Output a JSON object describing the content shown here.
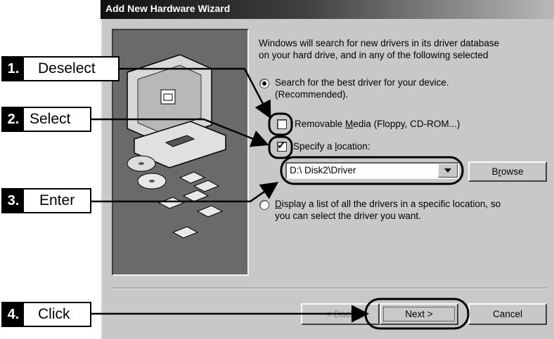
{
  "window": {
    "title": "Add New Hardware Wizard"
  },
  "content": {
    "intro_line1": "Windows will search for new drivers in its driver database",
    "intro_line2": "on your hard drive, and in any of the following selected",
    "radio_best_line1": "Search for the best driver for your device.",
    "radio_best_line2": "(Recommended).",
    "cb_removable_pre": "Removable ",
    "cb_removable_key": "M",
    "cb_removable_post": "edia (Floppy, CD-ROM...)",
    "cb_location_pre": "Specify a ",
    "cb_location_key": "l",
    "cb_location_post": "ocation:",
    "location_value": "D:\\ Disk2\\Driver",
    "browse_pre": "B",
    "browse_key": "r",
    "browse_post": "owse",
    "radio_list_key": "D",
    "radio_list_line1_post": "isplay a list of all the drivers in a specific location, so",
    "radio_list_line2": "you can select the driver you want."
  },
  "buttons": {
    "back": "< Back",
    "next": "Next >",
    "cancel": "Cancel"
  },
  "callouts": [
    {
      "number": "1.",
      "label": "Deselect"
    },
    {
      "number": "2.",
      "label": "Select"
    },
    {
      "number": "3.",
      "label": "Enter"
    },
    {
      "number": "4.",
      "label": "Click"
    }
  ],
  "state": {
    "radio_best_selected": true,
    "removable_media_checked": false,
    "specify_location_checked": true,
    "back_enabled": false
  },
  "colors": {
    "titlebar_dark": "#101010",
    "dialog_face": "#c8c8c8",
    "art_panel": "#6a6a6a"
  }
}
